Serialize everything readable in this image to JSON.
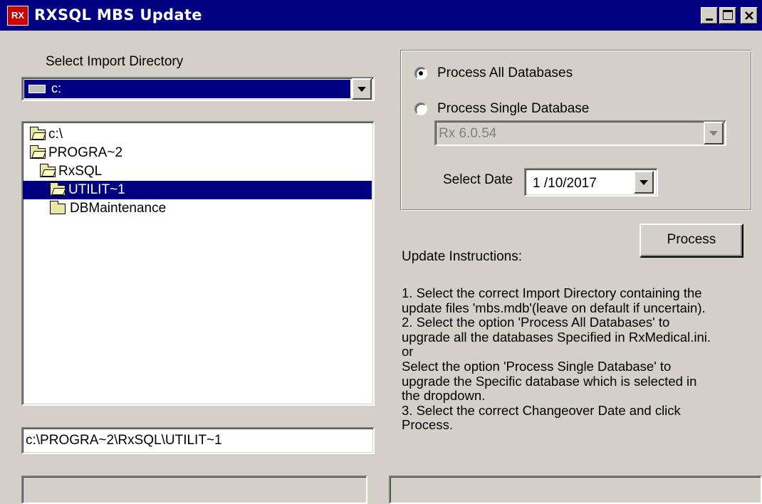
{
  "window": {
    "title": "RXSQL MBS Update",
    "logo_text": "RX",
    "controls": [
      "minimize",
      "maximize",
      "close"
    ]
  },
  "import": {
    "label": "Select Import Directory",
    "drive_value": "c:",
    "tree": [
      {
        "label": "c:\\",
        "icon": "folder-open-icon",
        "selected": false
      },
      {
        "label": "PROGRA~2",
        "icon": "folder-open-icon",
        "selected": false
      },
      {
        "label": "RxSQL",
        "icon": "folder-open-icon",
        "selected": false
      },
      {
        "label": "UTILIT~1",
        "icon": "folder-open-icon",
        "selected": true
      },
      {
        "label": "DBMaintenance",
        "icon": "folder-closed-icon",
        "selected": false
      }
    ],
    "path_value": "c:\\PROGRA~2\\RxSQL\\UTILIT~1"
  },
  "options": {
    "process_all_label": "Process All Databases",
    "process_single_label": "Process Single Database",
    "selected_option": "process_all",
    "database_value": "Rx 6.0.54",
    "date_label": "Select Date",
    "date_value": "1 /10/2017"
  },
  "actions": {
    "process_label": "Process"
  },
  "instructions": {
    "heading": "Update Instructions:",
    "lines": [
      "1. Select the correct Import Directory containing the",
      "update files 'mbs.mdb'(leave on default if uncertain).",
      "2. Select the option 'Process All Databases' to",
      "upgrade all the databases Specified in RxMedical.ini.",
      "or",
      "Select the option 'Process Single Database' to",
      "upgrade the Specific database which is selected in",
      "the dropdown.",
      "3. Select the correct Changeover Date and click",
      "Process."
    ]
  },
  "colors": {
    "titlebar": "#000080",
    "face": "#d4d0c8",
    "selection": "#000080",
    "disabled_text": "#808080"
  }
}
